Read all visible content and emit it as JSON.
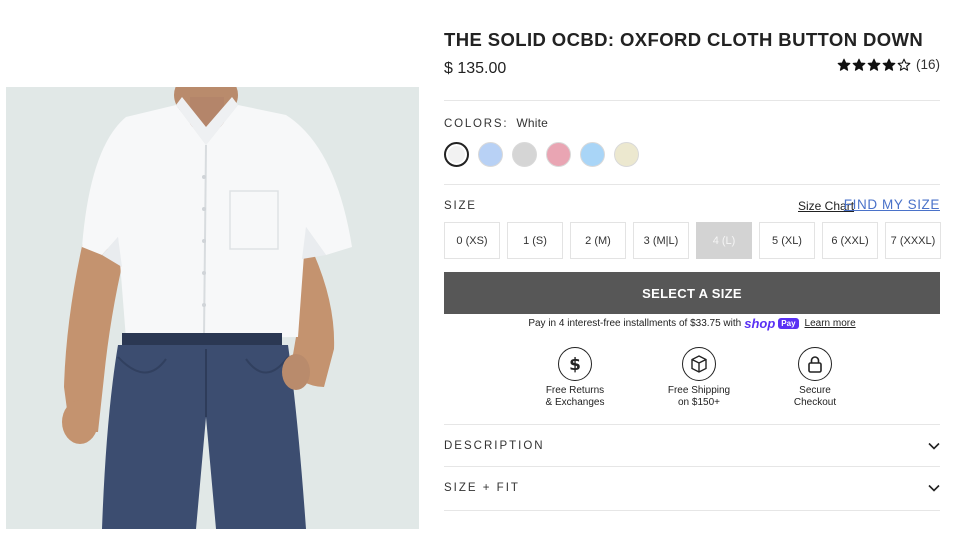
{
  "product": {
    "title": "THE SOLID OCBD: OXFORD CLOTH BUTTON DOWN",
    "price": "$ 135.00",
    "rating": 4,
    "rating_max": 5,
    "review_count": "(16)"
  },
  "colors": {
    "label": "COLORS:",
    "selected": "White",
    "swatches": [
      {
        "name": "White",
        "hex": "#f2f2f2"
      },
      {
        "name": "Light Blue",
        "hex": "#b8d1f5"
      },
      {
        "name": "Light Grey",
        "hex": "#d5d5d5"
      },
      {
        "name": "Pink",
        "hex": "#e9a5b3"
      },
      {
        "name": "Sky Blue",
        "hex": "#a9d5f7"
      },
      {
        "name": "Ecru",
        "hex": "#ece8cf"
      }
    ]
  },
  "size": {
    "label": "SIZE",
    "size_chart": "Size Chart",
    "find_my_size": "FIND MY SIZE",
    "options": [
      {
        "label": "0 (XS)",
        "available": true
      },
      {
        "label": "1 (S)",
        "available": true
      },
      {
        "label": "2 (M)",
        "available": true
      },
      {
        "label": "3 (M|L)",
        "available": true
      },
      {
        "label": "4 (L)",
        "available": false
      },
      {
        "label": "5 (XL)",
        "available": true
      },
      {
        "label": "6 (XXL)",
        "available": true
      },
      {
        "label": "7 (XXXL)",
        "available": true
      }
    ]
  },
  "cta": {
    "select_size": "SELECT A SIZE"
  },
  "installments": {
    "text": "Pay in 4 interest-free installments of $33.75 with",
    "shop": "shop",
    "pay": "Pay",
    "learn_more": "Learn more"
  },
  "perks": [
    {
      "icon": "dollar-icon",
      "line1": "Free Returns",
      "line2": "& Exchanges"
    },
    {
      "icon": "box-icon",
      "line1": "Free Shipping",
      "line2": "on $150+"
    },
    {
      "icon": "lock-icon",
      "line1": "Secure",
      "line2": "Checkout"
    }
  ],
  "accordions": [
    {
      "label": "DESCRIPTION"
    },
    {
      "label": "SIZE + FIT"
    }
  ],
  "theme": {
    "accent": "#4a72c9",
    "button": "#575757",
    "shop_pay": "#5a31f4"
  }
}
